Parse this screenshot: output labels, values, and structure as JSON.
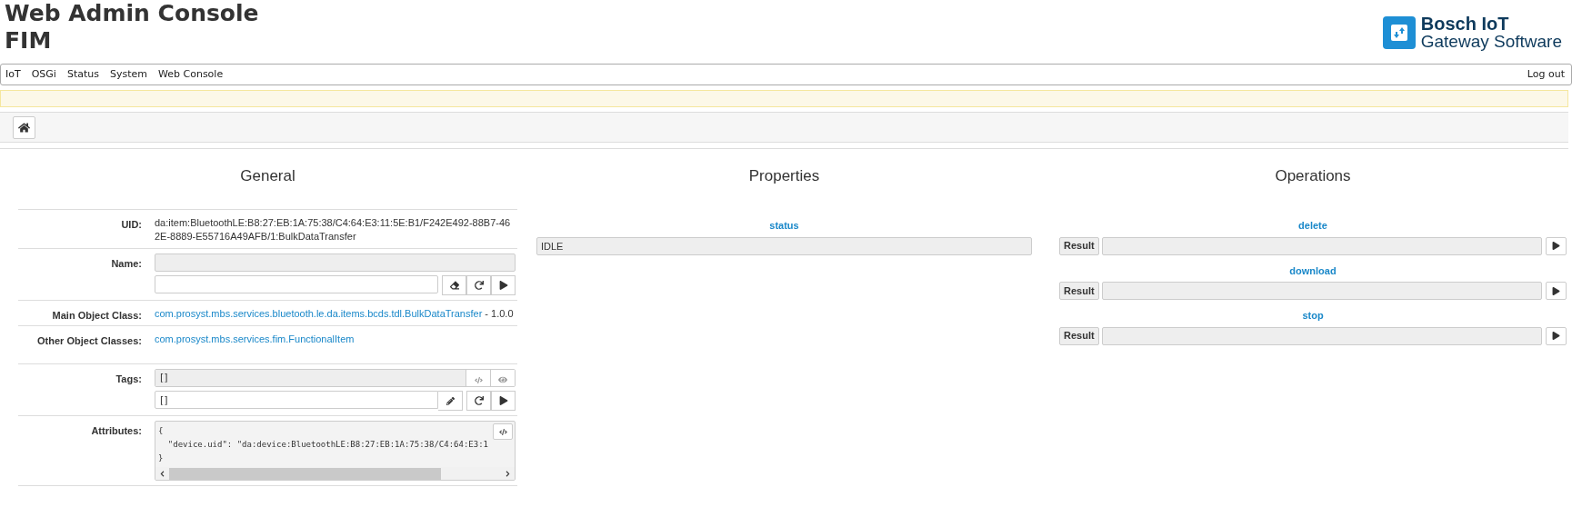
{
  "header": {
    "title": "Web Admin Console",
    "subtitle": "FIM",
    "logo": {
      "brand": "Bosch IoT",
      "product": "Gateway Software"
    }
  },
  "nav": {
    "items": [
      "IoT",
      "OSGi",
      "Status",
      "System",
      "Web Console"
    ],
    "logout": "Log out"
  },
  "general": {
    "heading": "General",
    "uid": {
      "label": "UID:",
      "value": "da:item:BluetoothLE:B8:27:EB:1A:75:38/C4:64:E3:11:5E:B1/F242E492-88B7-462E-8889-E55716A49AFB/1:BulkDataTransfer"
    },
    "name": {
      "label": "Name:"
    },
    "main_class": {
      "label": "Main Object Class:",
      "link": "com.prosyst.mbs.services.bluetooth.le.da.items.bcds.tdl.BulkDataTransfer",
      "version": "- 1.0.0"
    },
    "other_classes": {
      "label": "Other Object Classes:",
      "link": "com.prosyst.mbs.services.fim.FunctionalItem"
    },
    "tags": {
      "label": "Tags:",
      "current": "[]",
      "value": "[]"
    },
    "attributes": {
      "label": "Attributes:",
      "lines": [
        "{",
        "  \"device.uid\": \"da:device:BluetoothLE:B8:27:EB:1A:75:38/C4:64:E3:1",
        "}"
      ]
    }
  },
  "properties": {
    "heading": "Properties",
    "items": [
      {
        "name": "status",
        "value": "IDLE"
      }
    ]
  },
  "operations": {
    "heading": "Operations",
    "items": [
      {
        "name": "delete",
        "button": "Result"
      },
      {
        "name": "download",
        "button": "Result"
      },
      {
        "name": "stop",
        "button": "Result"
      }
    ]
  }
}
